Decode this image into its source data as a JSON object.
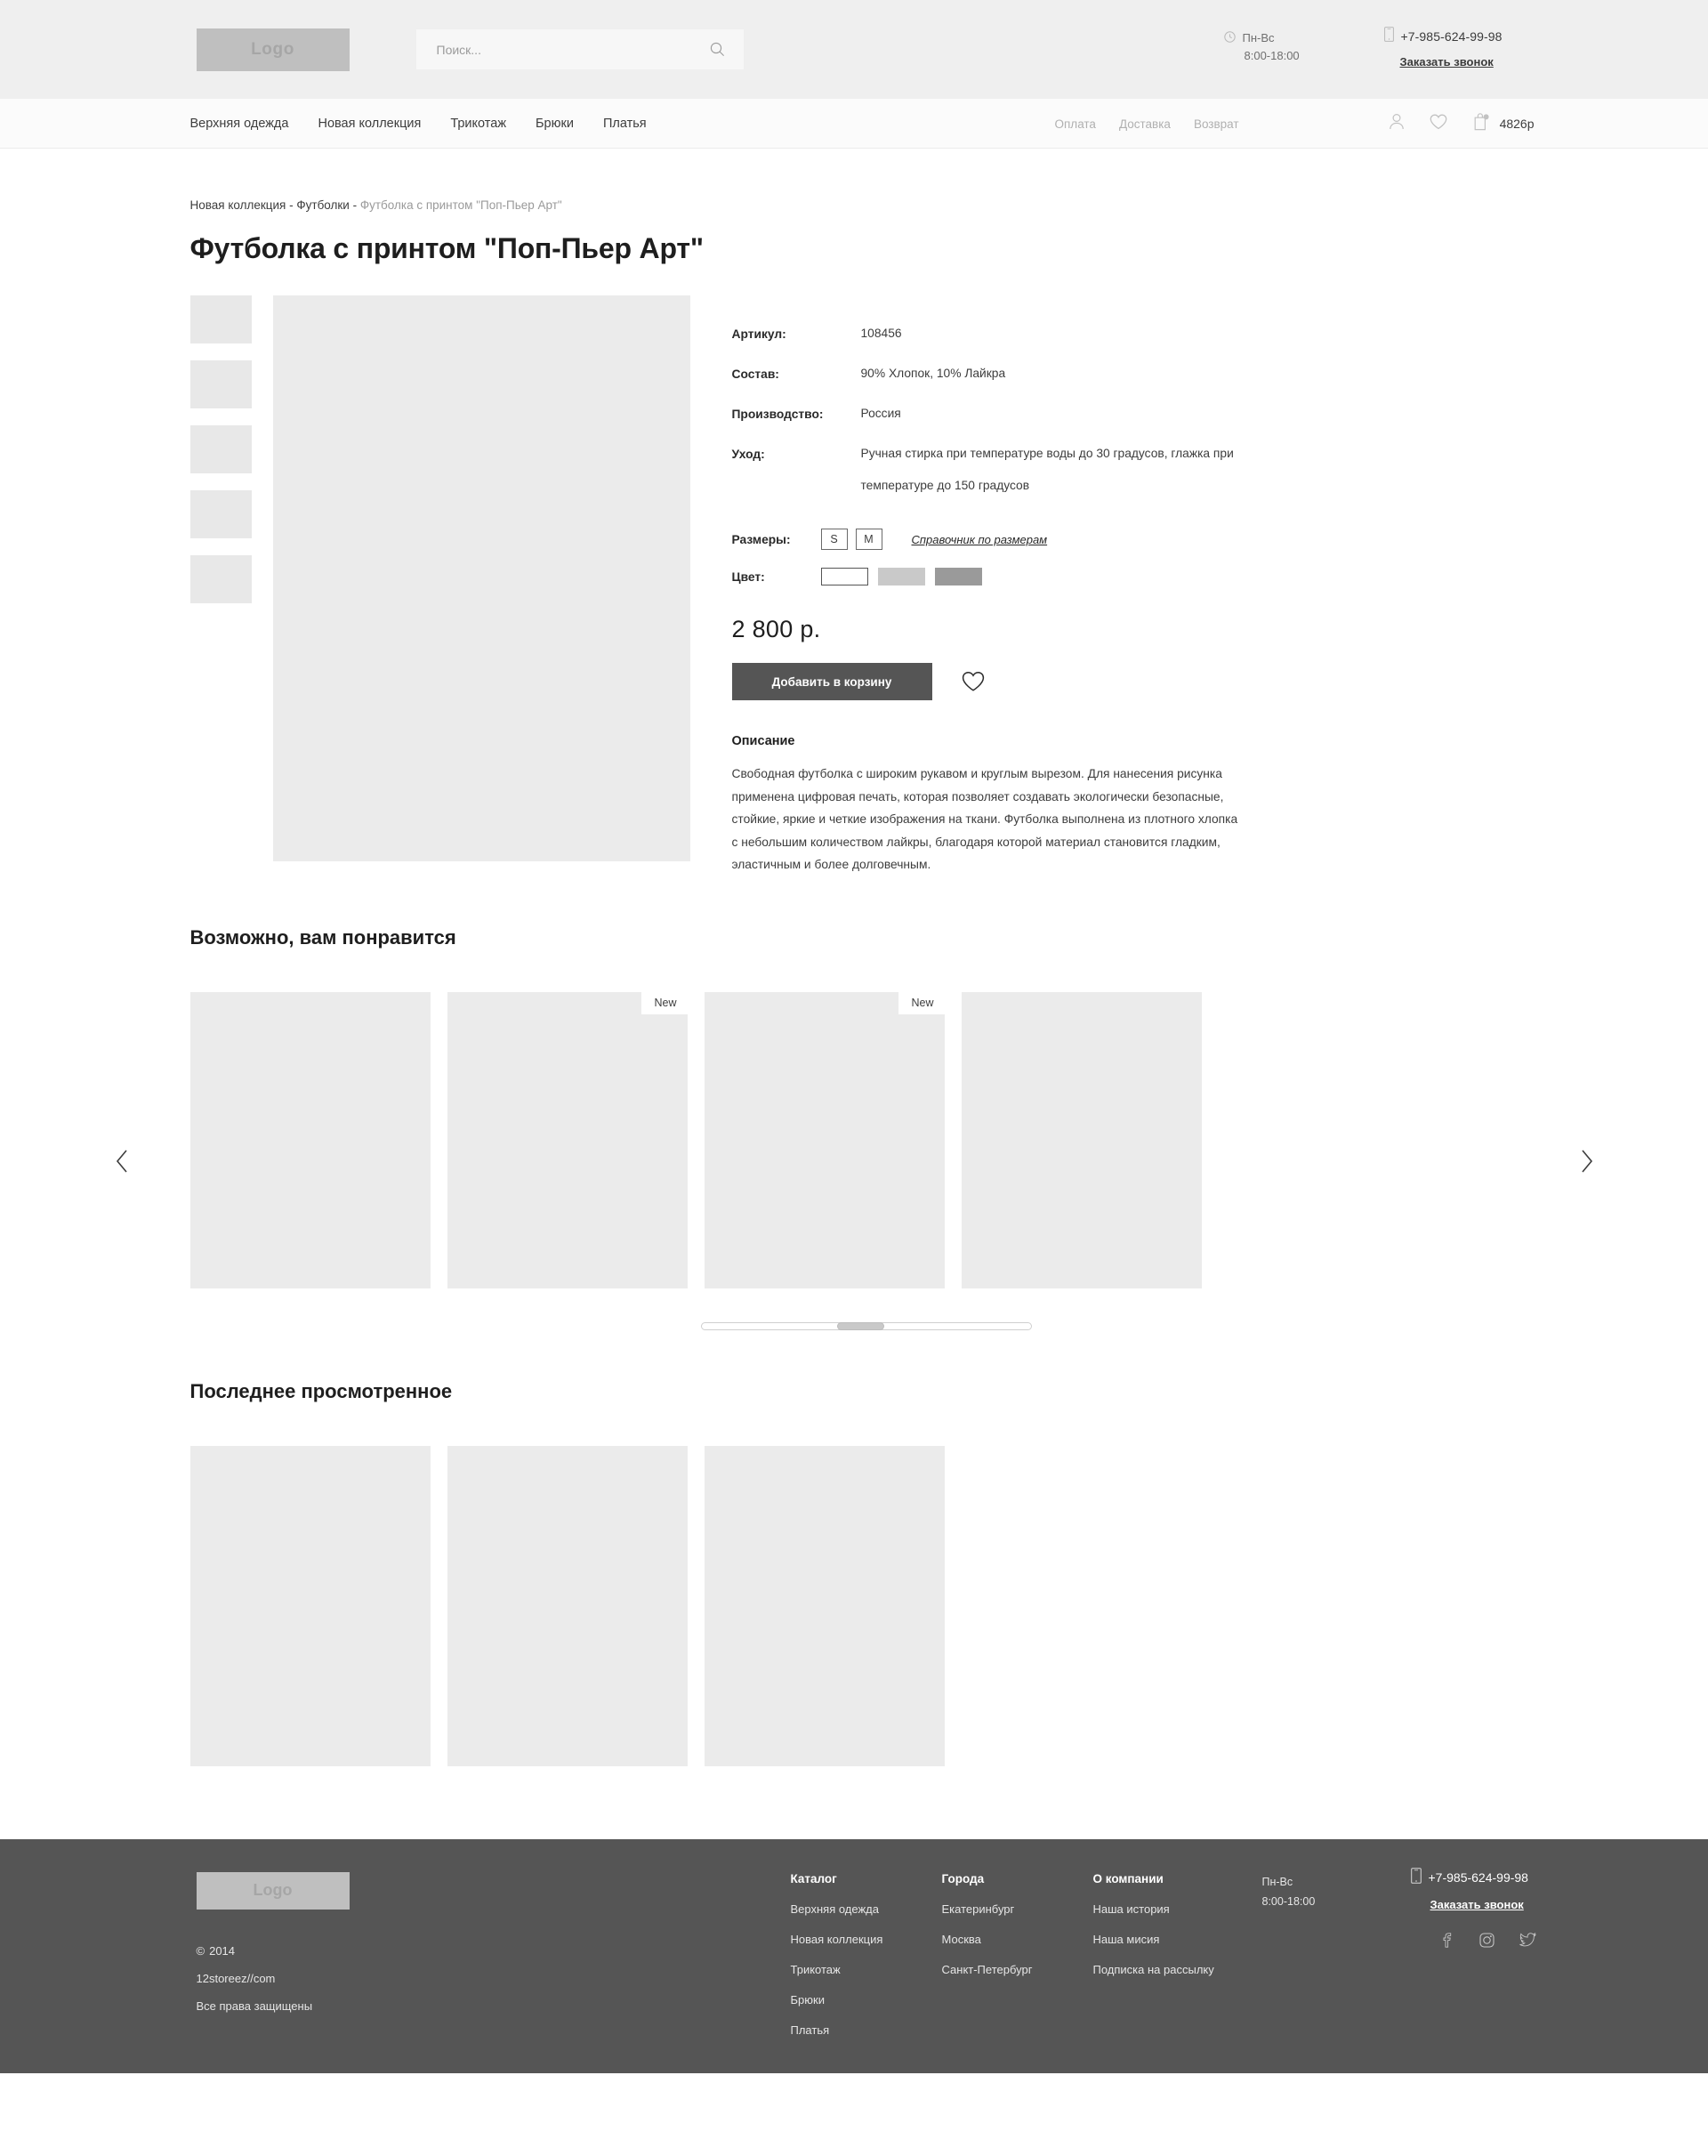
{
  "header": {
    "logo_text": "Logo",
    "search": {
      "placeholder": "Поиск...",
      "value": "",
      "icon": "search-icon"
    },
    "hours": {
      "icon": "clock-icon",
      "days": "Пн-Вс",
      "time": "8:00-18:00"
    },
    "contact": {
      "icon": "phone-icon",
      "phone": "+7-985-624-99-98",
      "callback_label": "Заказать звонок"
    }
  },
  "nav": {
    "main_items": [
      {
        "label": "Верхняя одежда"
      },
      {
        "label": "Новая коллекция"
      },
      {
        "label": "Трикотаж"
      },
      {
        "label": "Брюки"
      },
      {
        "label": "Платья"
      }
    ],
    "secondary_items": [
      {
        "label": "Оплата"
      },
      {
        "label": "Доставка"
      },
      {
        "label": "Возврат"
      }
    ],
    "icons": {
      "account": "user-icon",
      "wishlist": "heart-icon",
      "cart": "cart-icon"
    },
    "cart_total": "4826р"
  },
  "breadcrumb": {
    "item1": "Новая коллекция",
    "sep1": " - ",
    "item2": "Футболки",
    "sep2": " - ",
    "current": "Футболка с принтом \"Поп-Пьер Арт\""
  },
  "product": {
    "title": "Футболка с принтом \"Поп-Пьер Арт\"",
    "specs": [
      {
        "label": "Артикул:",
        "value": "108456"
      },
      {
        "label": "Состав:",
        "value": "90% Хлопок, 10% Лайкра"
      },
      {
        "label": "Производство:",
        "value": "Россия"
      },
      {
        "label": "Уход:",
        "value": "Ручная стирка при температуре воды до 30 градусов, глажка при температуре до 150 градусов"
      }
    ],
    "sizes_label": "Размеры:",
    "sizes": [
      {
        "label": "S"
      },
      {
        "label": "M"
      }
    ],
    "size_guide_label": "Справочник по размерам",
    "color_label": "Цвет:",
    "colors": [
      {
        "name": "white",
        "hex": "#ffffff"
      },
      {
        "name": "light-gray",
        "hex": "#c9c9c9"
      },
      {
        "name": "dark-gray",
        "hex": "#9a9a9a"
      }
    ],
    "price": "2 800 р.",
    "add_to_cart_label": "Добавить в корзину",
    "fav_icon": "heart-icon",
    "description_title": "Описание",
    "description_body": "Свободная футболка с широким рукавом и круглым вырезом. Для нанесения рисунка применена цифровая печать, которая позволяет создавать экологически безопасные, стойкие, яркие и четкие изображения на ткани. Футболка выполнена из плотного хлопка с небольшим количеством лайкры, благодаря которой материал становится гладким, эластичным и более долговечным.",
    "thumbnails": [
      {},
      {},
      {},
      {},
      {}
    ]
  },
  "recommendations": {
    "title": "Возможно, вам понравится",
    "badge_new": "New",
    "cards": [
      {
        "badge": ""
      },
      {
        "badge": "New"
      },
      {
        "badge": "New"
      },
      {
        "badge": ""
      }
    ],
    "prev_icon": "chevron-left-icon",
    "next_icon": "chevron-right-icon"
  },
  "recent": {
    "title": "Последнее просмотренное",
    "cards": [
      {},
      {},
      {}
    ]
  },
  "footer": {
    "logo_text": "Logo",
    "copyright_symbol": "©",
    "copyright_year": "2014",
    "site": "12storeez//com",
    "rights": "Все права защищены",
    "catalog": {
      "title": "Каталог",
      "items": [
        {
          "label": "Верхняя одежда"
        },
        {
          "label": "Новая коллекция"
        },
        {
          "label": "Трикотаж"
        },
        {
          "label": "Брюки"
        },
        {
          "label": "Платья"
        }
      ]
    },
    "cities": {
      "title": "Города",
      "items": [
        {
          "label": "Екатеринбург"
        },
        {
          "label": "Москва"
        },
        {
          "label": "Санкт-Петербург"
        }
      ]
    },
    "about": {
      "title": "О компании",
      "items": [
        {
          "label": "Наша история"
        },
        {
          "label": "Наша мисия"
        },
        {
          "label": "Подписка на рассылку"
        }
      ]
    },
    "hours": {
      "days": "Пн-Вс",
      "time": "8:00-18:00"
    },
    "contact": {
      "phone": "+7-985-624-99-98",
      "callback_label": "Заказать звонок"
    },
    "social": [
      {
        "name": "facebook-icon"
      },
      {
        "name": "instagram-icon"
      },
      {
        "name": "twitter-icon"
      }
    ]
  },
  "colors": {
    "header_bg": "#efefef",
    "nav_bg": "#fbfbfb",
    "footer_bg": "#555555",
    "placeholder_gray": "#ebebeb",
    "button_dark": "#555555"
  }
}
